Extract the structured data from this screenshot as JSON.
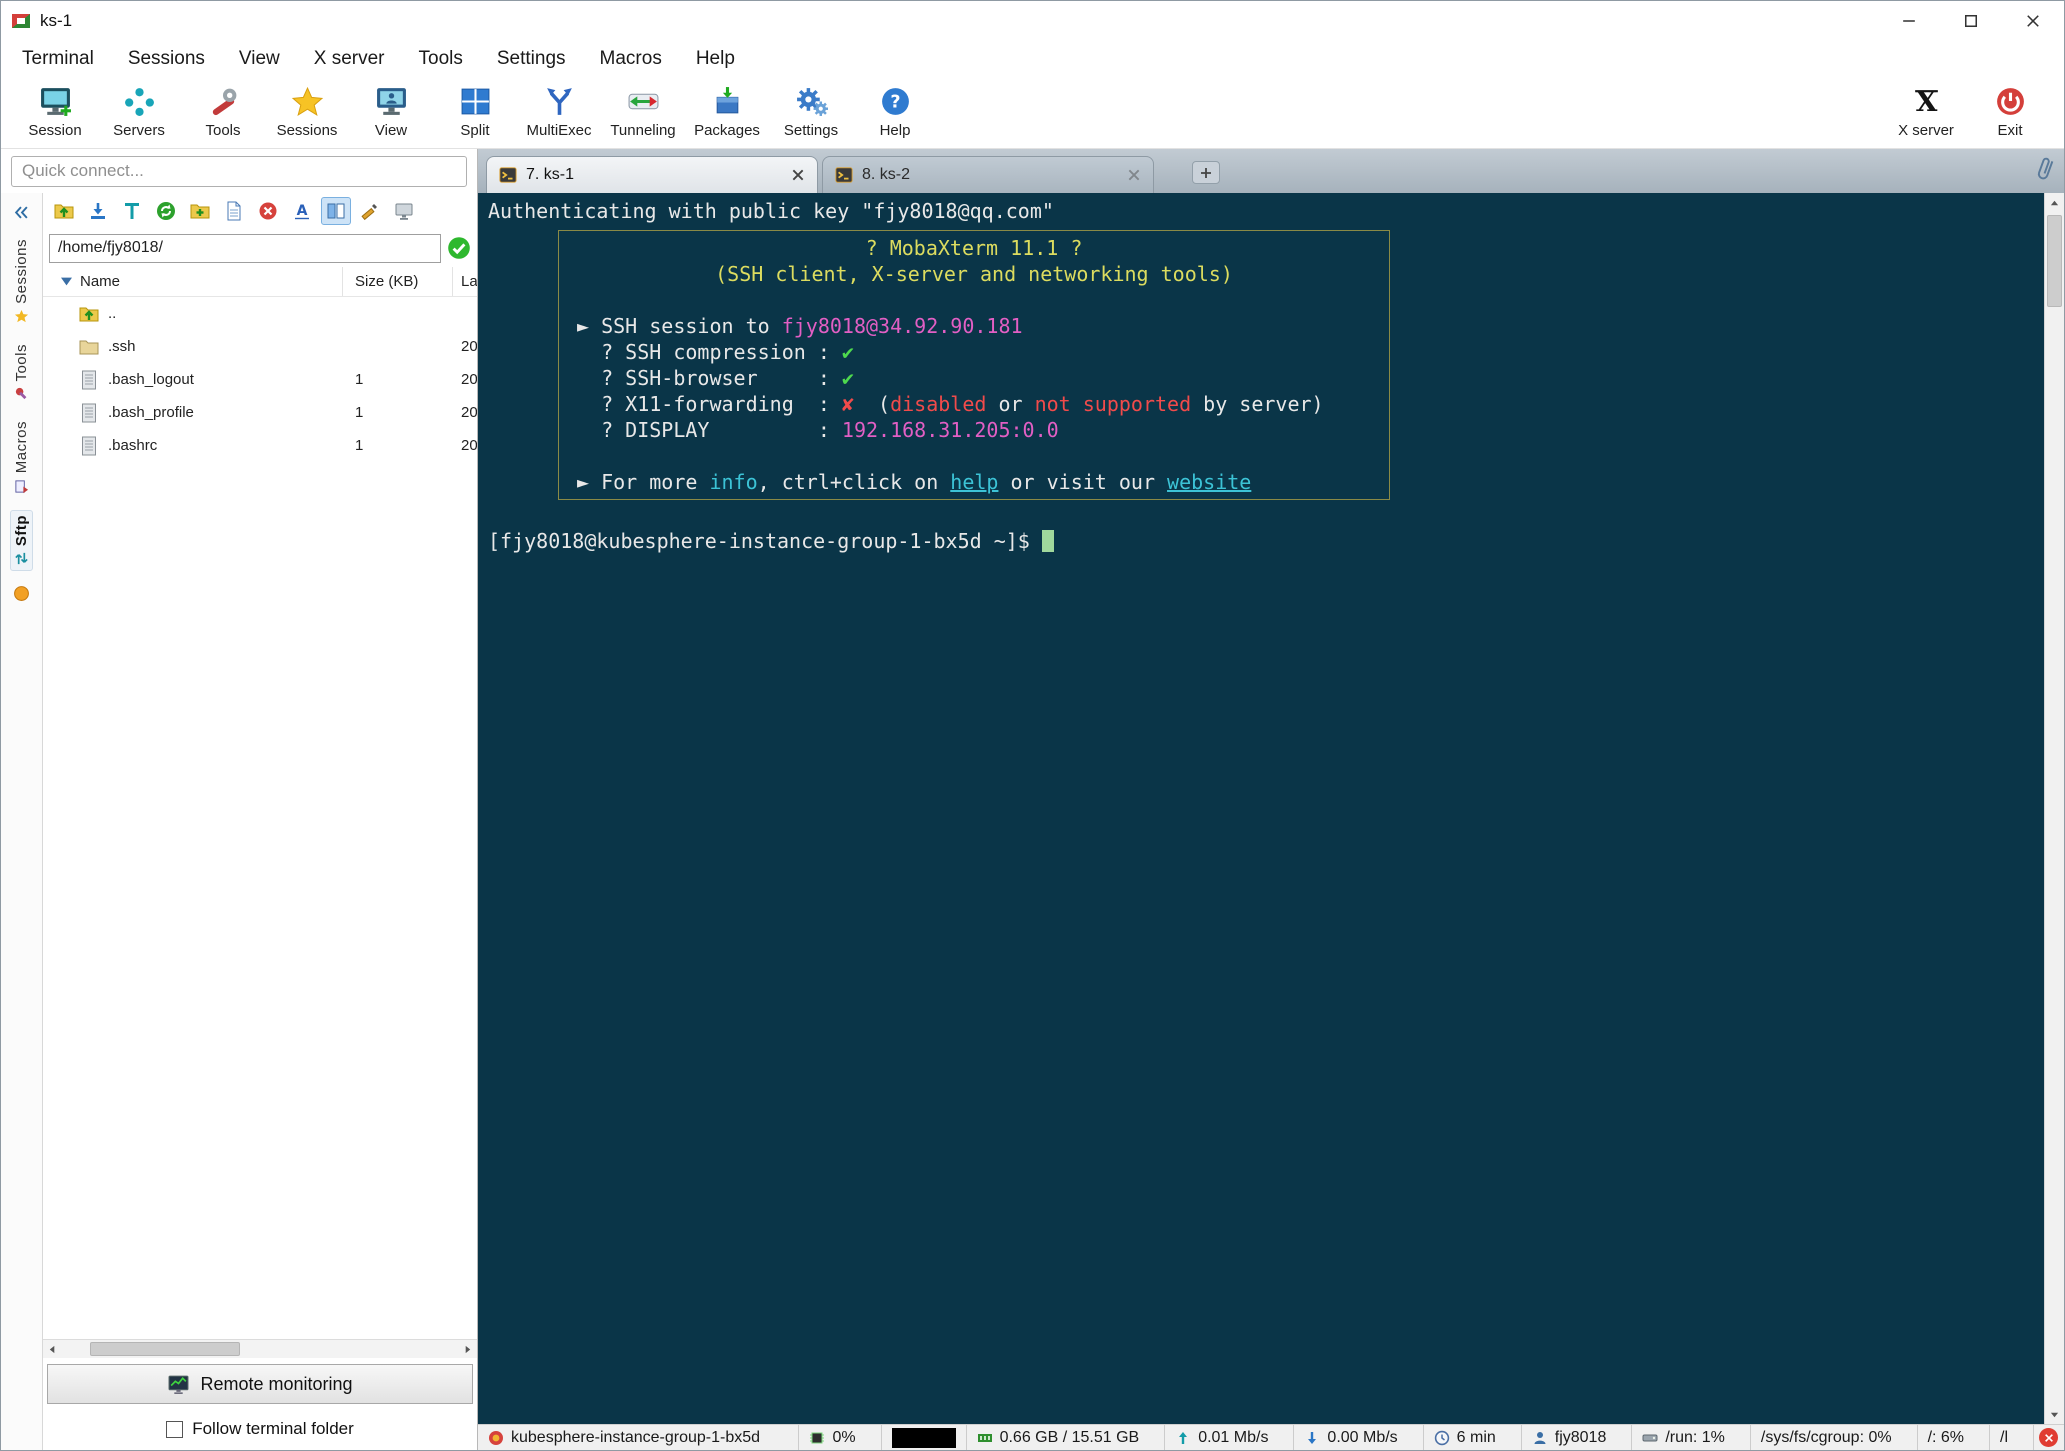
{
  "window": {
    "title": "ks-1"
  },
  "quick_connect_placeholder": "Quick connect...",
  "menubar": [
    "Terminal",
    "Sessions",
    "View",
    "X server",
    "Tools",
    "Settings",
    "Macros",
    "Help"
  ],
  "toolbar_left": [
    {
      "label": "Session",
      "icon": "session-icon"
    },
    {
      "label": "Servers",
      "icon": "servers-icon"
    },
    {
      "label": "Tools",
      "icon": "tools-icon"
    },
    {
      "label": "Sessions",
      "icon": "sessions-icon"
    },
    {
      "label": "View",
      "icon": "view-icon"
    },
    {
      "label": "Split",
      "icon": "split-icon"
    },
    {
      "label": "MultiExec",
      "icon": "multiexec-icon"
    },
    {
      "label": "Tunneling",
      "icon": "tunneling-icon"
    },
    {
      "label": "Packages",
      "icon": "packages-icon"
    },
    {
      "label": "Settings",
      "icon": "settings-icon"
    },
    {
      "label": "Help",
      "icon": "help-icon"
    }
  ],
  "toolbar_right": [
    {
      "label": "X server",
      "icon": "xserver-icon"
    },
    {
      "label": "Exit",
      "icon": "exit-icon"
    }
  ],
  "side_tabs": [
    {
      "label": "Sessions",
      "icon": "star-icon"
    },
    {
      "label": "Tools",
      "icon": "tools-mini-icon"
    },
    {
      "label": "Macros",
      "icon": "macros-mini-icon"
    },
    {
      "label": "Sftp",
      "icon": "sftp-mini-icon",
      "active": true
    }
  ],
  "sftp": {
    "toolbar_icons": [
      {
        "name": "parent-directory-icon"
      },
      {
        "name": "download-icon"
      },
      {
        "name": "upload-icon"
      },
      {
        "name": "refresh-icon"
      },
      {
        "name": "new-folder-icon"
      },
      {
        "name": "new-file-icon"
      },
      {
        "name": "delete-icon"
      },
      {
        "name": "rename-icon"
      },
      {
        "name": "split-browser-icon",
        "selected": true
      },
      {
        "name": "edit-icon"
      },
      {
        "name": "follow-terminal-icon"
      }
    ],
    "path": "/home/fjy8018/",
    "columns": [
      "Name",
      "Size (KB)",
      "La"
    ],
    "rows": [
      {
        "name": "..",
        "size": "",
        "last": "",
        "icon": "parent-directory-icon"
      },
      {
        "name": ".ssh",
        "size": "",
        "last": "20",
        "icon": "folder-icon"
      },
      {
        "name": ".bash_logout",
        "size": "1",
        "last": "20",
        "icon": "file-icon"
      },
      {
        "name": ".bash_profile",
        "size": "1",
        "last": "20",
        "icon": "file-icon"
      },
      {
        "name": ".bashrc",
        "size": "1",
        "last": "20",
        "icon": "file-icon"
      }
    ],
    "remote_monitoring_label": "Remote monitoring",
    "follow_label": "Follow terminal folder"
  },
  "tabs": [
    {
      "label": "7. ks-1",
      "active": true
    },
    {
      "label": "8. ks-2",
      "active": false
    }
  ],
  "terminal": {
    "auth_line": "Authenticating with public key \"fjy8018@qq.com\"",
    "banner_lines": [
      {
        "align": "center",
        "segs": [
          {
            "t": "? MobaXterm 11.1 ?",
            "c": "yellow"
          }
        ]
      },
      {
        "align": "center",
        "segs": [
          {
            "t": "(SSH client, X-server and networking tools)",
            "c": "yellow"
          }
        ]
      },
      {
        "segs": []
      },
      {
        "segs": [
          {
            "t": "► SSH session to "
          },
          {
            "t": "fjy8018@34.92.90.181",
            "c": "magenta"
          }
        ]
      },
      {
        "segs": [
          {
            "t": "  ? SSH compression : "
          },
          {
            "t": "✔",
            "c": "green"
          }
        ]
      },
      {
        "segs": [
          {
            "t": "  ? SSH-browser     : "
          },
          {
            "t": "✔",
            "c": "green"
          }
        ]
      },
      {
        "segs": [
          {
            "t": "  ? X11-forwarding  : "
          },
          {
            "t": "✘",
            "c": "red"
          },
          {
            "t": "  ("
          },
          {
            "t": "disabled",
            "c": "red"
          },
          {
            "t": " or "
          },
          {
            "t": "not supported",
            "c": "red"
          },
          {
            "t": " by server)"
          }
        ]
      },
      {
        "segs": [
          {
            "t": "  ? DISPLAY         : "
          },
          {
            "t": "192.168.31.205:0.0",
            "c": "magenta"
          }
        ]
      },
      {
        "segs": []
      },
      {
        "segs": [
          {
            "t": "► For more "
          },
          {
            "t": "info",
            "c": "cyan"
          },
          {
            "t": ", ctrl+click on "
          },
          {
            "t": "help",
            "c": "cyan link"
          },
          {
            "t": " or visit our "
          },
          {
            "t": "website",
            "c": "cyan link"
          }
        ]
      }
    ],
    "prompt": "[fjy8018@kubesphere-instance-group-1-bx5d ~]$"
  },
  "statusbar": [
    {
      "icon": "host-icon",
      "text": "kubesphere-instance-group-1-bx5d"
    },
    {
      "icon": "cpu-icon",
      "text": "0%"
    },
    {
      "icon": "graph",
      "text": ""
    },
    {
      "icon": "ram-icon",
      "text": "0.66 GB / 15.51 GB"
    },
    {
      "icon": "net-up-icon",
      "text": "0.01 Mb/s"
    },
    {
      "icon": "net-down-icon",
      "text": "0.00 Mb/s"
    },
    {
      "icon": "clock-icon",
      "text": "6 min"
    },
    {
      "icon": "user-icon",
      "text": "fjy8018"
    },
    {
      "icon": "disk-icon",
      "text": "/run: 1%"
    },
    {
      "icon": "none",
      "text": "/sys/fs/cgroup: 0%"
    },
    {
      "icon": "none",
      "text": "/: 6%"
    },
    {
      "icon": "none",
      "text": "/l"
    }
  ],
  "colors": {
    "term_bg": "#0a3548",
    "term_fg": "#e8e8e8",
    "banner_border": "#8a8a46",
    "yellow": "#dcdc5f",
    "magenta": "#e25fc4",
    "green": "#4ed94e",
    "red": "#f14b4b",
    "cyan": "#3cc3d6",
    "cursor": "#a0d89c",
    "accent_blue": "#2e6da4"
  }
}
